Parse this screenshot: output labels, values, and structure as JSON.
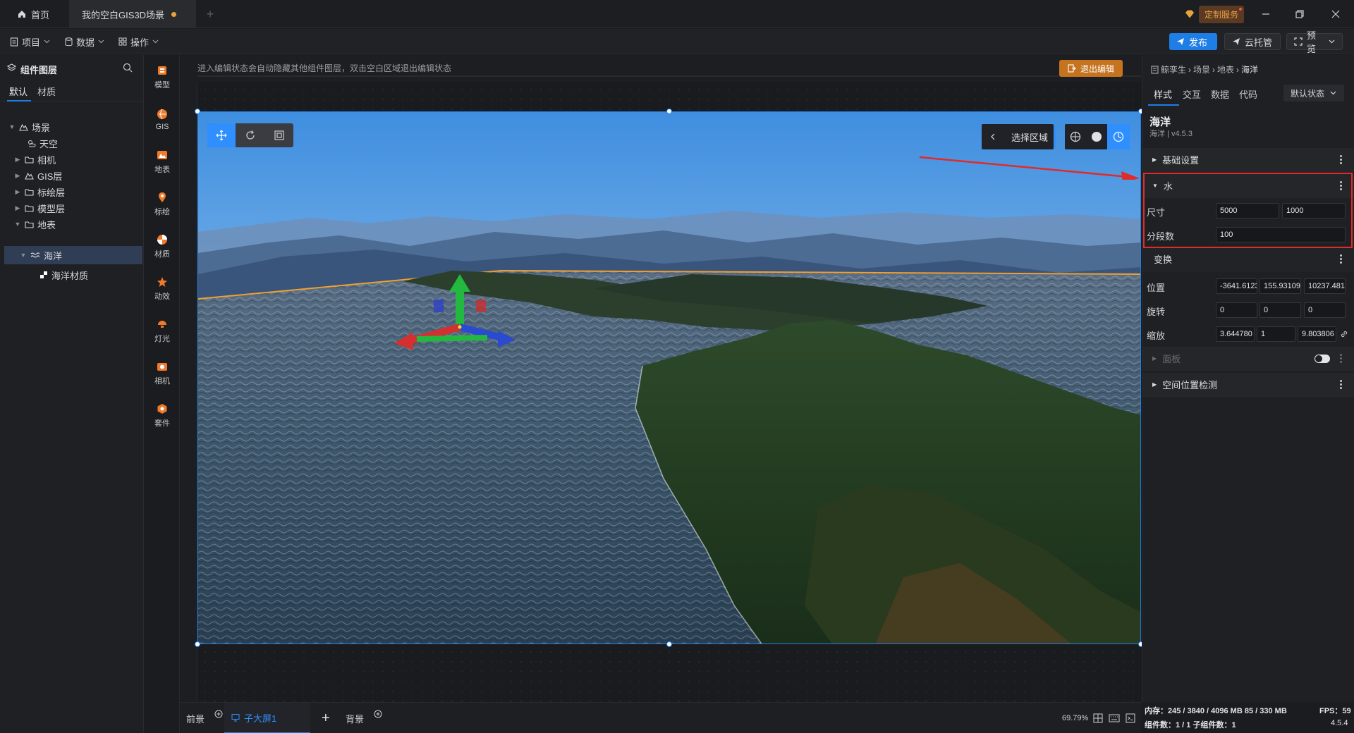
{
  "titlebar": {
    "home_tab": "首页",
    "scene_tab": "我的空白GIS3D场景",
    "custom_service": "定制服务"
  },
  "menubar": {
    "project": "项目",
    "data": "数据",
    "operation": "操作",
    "publish": "发布",
    "cloud_host": "云托管",
    "preview": "预览"
  },
  "layers": {
    "title": "组件图层",
    "tab_default": "默认",
    "tab_material": "材质",
    "items": [
      {
        "label": "场景"
      },
      {
        "label": "天空"
      },
      {
        "label": "相机"
      },
      {
        "label": "GIS层"
      },
      {
        "label": "标绘层"
      },
      {
        "label": "模型层"
      },
      {
        "label": "地表"
      },
      {
        "label": "海洋"
      },
      {
        "label": "海洋材质"
      }
    ]
  },
  "tools": [
    {
      "label": "模型"
    },
    {
      "label": "GIS"
    },
    {
      "label": "地表"
    },
    {
      "label": "标绘"
    },
    {
      "label": "材质"
    },
    {
      "label": "动效"
    },
    {
      "label": "灯光"
    },
    {
      "label": "相机"
    },
    {
      "label": "套件"
    }
  ],
  "canvas": {
    "notice": "进入编辑状态会自动隐藏其他组件图层，双击空白区域退出编辑状态",
    "exit_edit": "退出编辑",
    "select_area": "选择区域"
  },
  "bottom": {
    "front": "前景",
    "sub_screen": "子大屏1",
    "background": "背景",
    "zoom": "69.79%"
  },
  "properties": {
    "breadcrumb": [
      "鲸孪生",
      "场景",
      "地表",
      "海洋"
    ],
    "tabs": [
      "样式",
      "交互",
      "数据",
      "代码"
    ],
    "state": "默认状态",
    "component_name": "海洋",
    "component_version": "海洋 | v4.5.3",
    "sections": {
      "basic": "基础设置",
      "water": "水",
      "transform": "变换",
      "panel": "面板",
      "spatial": "空间位置检测"
    },
    "water": {
      "size_label": "尺寸",
      "size_w": "5000",
      "size_h": "1000",
      "segments_label": "分段数",
      "segments": "100"
    },
    "transform": {
      "position_label": "位置",
      "position": [
        "-3641.6123",
        "155.93109",
        "10237.481"
      ],
      "rotation_label": "旋转",
      "rotation": [
        "0",
        "0",
        "0"
      ],
      "scale_label": "缩放",
      "scale": [
        "3.644780",
        "1",
        "9.803806"
      ]
    }
  },
  "status": {
    "memory": "内存：245 / 3840 / 4096 MB  85 / 330 MB",
    "fps": "FPS：59",
    "components": "组件数：1 / 1    子组件数：1",
    "version": "4.5.4"
  },
  "colors": {
    "accent": "#1e7ee6",
    "highlight": "#e02b2b",
    "exit_edit": "#c6731f"
  }
}
